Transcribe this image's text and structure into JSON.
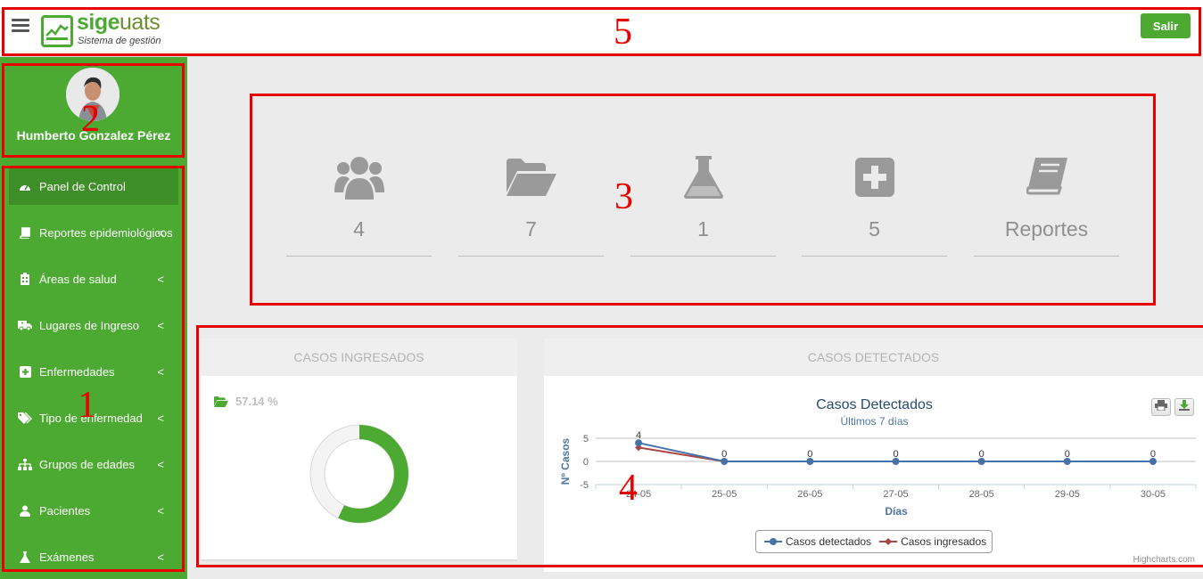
{
  "header": {
    "logo_name_a": "sige",
    "logo_name_b": "uats",
    "logo_subtitle": "Sistema de gestión",
    "logout_label": "Salir",
    "menu_icon": "hamburger-menu-icon"
  },
  "user": {
    "name": "Humberto Gonzalez Pérez",
    "avatar_icon": "user-avatar"
  },
  "sidebar": {
    "items": [
      {
        "label": "Panel de Control",
        "icon": "dashboard-icon",
        "active": true,
        "chevron": ""
      },
      {
        "label": "Reportes epidemiológicos",
        "icon": "book-icon",
        "chevron": "<"
      },
      {
        "label": "Áreas de salud",
        "icon": "hospital-icon",
        "chevron": "<"
      },
      {
        "label": "Lugares de Ingreso",
        "icon": "ambulance-icon",
        "chevron": "<"
      },
      {
        "label": "Enfermedades",
        "icon": "plus-square-icon",
        "chevron": "<"
      },
      {
        "label": "Tipo de enfermedad",
        "icon": "tags-icon",
        "chevron": "<"
      },
      {
        "label": "Grupos de edades",
        "icon": "sitemap-icon",
        "chevron": "<"
      },
      {
        "label": "Pacientes",
        "icon": "user-icon",
        "chevron": "<"
      },
      {
        "label": "Exámenes",
        "icon": "flask-icon",
        "chevron": "<"
      }
    ]
  },
  "stats": [
    {
      "value": "4",
      "icon": "users-icon"
    },
    {
      "value": "7",
      "icon": "folder-open-icon"
    },
    {
      "value": "1",
      "icon": "flask-icon"
    },
    {
      "value": "5",
      "icon": "plus-square-icon"
    },
    {
      "value": "Reportes",
      "icon": "book-icon"
    }
  ],
  "annotations": [
    "1",
    "2",
    "3",
    "4",
    "5"
  ],
  "cards": {
    "ingresados": {
      "title": "CASOS INGRESADOS",
      "percent_label": "57.14 %",
      "percent": 57.14
    },
    "detectados": {
      "title": "CASOS DETECTADOS"
    }
  },
  "chart_data": {
    "type": "line",
    "title": "Casos Detectados",
    "subtitle": "Últimos 7 días",
    "xlabel": "Días",
    "ylabel": "Nº Casos",
    "categories": [
      "24-05",
      "25-05",
      "26-05",
      "27-05",
      "28-05",
      "29-05",
      "30-05"
    ],
    "yticks": [
      "5",
      "0",
      "-5"
    ],
    "ylim": [
      -5,
      5
    ],
    "grid": true,
    "series": [
      {
        "name": "Casos detectados",
        "values": [
          4,
          0,
          0,
          0,
          0,
          0,
          0
        ],
        "color": "#4572a7",
        "marker": "circle"
      },
      {
        "name": "Casos ingresados",
        "values": [
          3,
          0,
          0,
          0,
          0,
          0,
          0
        ],
        "color": "#aa4643",
        "marker": "diamond"
      }
    ],
    "data_labels": [
      "4",
      "0",
      "0",
      "0",
      "0",
      "0",
      "0"
    ],
    "credits": "Highcharts.com",
    "legend_position": "bottom"
  }
}
